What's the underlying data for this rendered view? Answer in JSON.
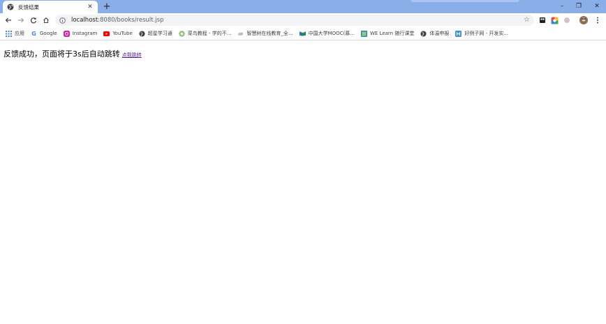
{
  "tab": {
    "title": "反馈结果"
  },
  "window": {
    "minimize": "–",
    "restore": "❐",
    "close": "✕"
  },
  "toolbar": {
    "url_host": "localhost",
    "url_rest": ":8080/books/result.jsp"
  },
  "bookmarks": [
    {
      "label": "应用",
      "icon": "apps-grid-icon"
    },
    {
      "label": "Google",
      "icon": "google-icon"
    },
    {
      "label": "Instagram",
      "icon": "instagram-icon"
    },
    {
      "label": "YouTube",
      "icon": "youtube-icon"
    },
    {
      "label": "超星学习通",
      "icon": "globe-icon"
    },
    {
      "label": "菜鸟教程 - 学的不...",
      "icon": "runoob-icon"
    },
    {
      "label": "智慧树在线教育_全...",
      "icon": "zhihuishu-icon"
    },
    {
      "label": "中国大学MOOC(慕...",
      "icon": "mooc-icon"
    },
    {
      "label": "WE Learn 随行课堂",
      "icon": "welearn-icon"
    },
    {
      "label": "体温申报",
      "icon": "globe-icon"
    },
    {
      "label": "好例子网 - 开发实...",
      "icon": "haolizi-icon"
    }
  ],
  "page": {
    "message": "反馈成功，页面将于3s后自动跳转",
    "link_text": "点我跳转"
  },
  "colors": {
    "tabstrip": "#89aee8",
    "link_visited": "#551a8b"
  }
}
